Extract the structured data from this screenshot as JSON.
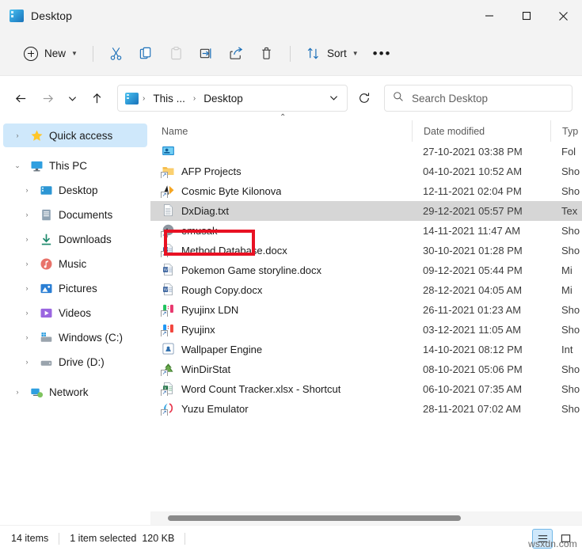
{
  "window": {
    "title": "Desktop",
    "title_icon": "desktop-folder-icon",
    "minimize_label": "Minimize",
    "maximize_label": "Maximize",
    "close_label": "Close"
  },
  "toolbar": {
    "new_label": "New",
    "cut_label": "Cut",
    "copy_label": "Copy",
    "paste_label": "Paste",
    "rename_label": "Rename",
    "share_label": "Share",
    "delete_label": "Delete",
    "sort_label": "Sort",
    "more_label": "See more"
  },
  "addressbar": {
    "back_label": "Back",
    "forward_label": "Forward",
    "recent_label": "Recent locations",
    "up_label": "Up",
    "crumb_root": "This ...",
    "crumb_current": "Desktop",
    "crumb_sep": "›",
    "refresh_label": "Refresh",
    "dropdown_label": "Previous locations"
  },
  "search": {
    "placeholder": "Search Desktop",
    "value": "",
    "icon": "search-icon"
  },
  "sidebar": {
    "items": [
      {
        "label": "Quick access",
        "icon": "star-icon",
        "level": 1,
        "expander": "›",
        "selected": true
      },
      {
        "label": "This PC",
        "icon": "monitor-icon",
        "level": 1,
        "expander": "⌄",
        "selected": false
      },
      {
        "label": "Desktop",
        "icon": "desktop-icon",
        "level": 2,
        "expander": "›",
        "selected": false
      },
      {
        "label": "Documents",
        "icon": "documents-icon",
        "level": 2,
        "expander": "›",
        "selected": false
      },
      {
        "label": "Downloads",
        "icon": "downloads-icon",
        "level": 2,
        "expander": "›",
        "selected": false
      },
      {
        "label": "Music",
        "icon": "music-icon",
        "level": 2,
        "expander": "›",
        "selected": false
      },
      {
        "label": "Pictures",
        "icon": "pictures-icon",
        "level": 2,
        "expander": "›",
        "selected": false
      },
      {
        "label": "Videos",
        "icon": "videos-icon",
        "level": 2,
        "expander": "›",
        "selected": false
      },
      {
        "label": "Windows (C:)",
        "icon": "system-drive-icon",
        "level": 2,
        "expander": "›",
        "selected": false
      },
      {
        "label": "Drive (D:)",
        "icon": "drive-icon",
        "level": 2,
        "expander": "›",
        "selected": false
      },
      {
        "label": "Network",
        "icon": "network-icon",
        "level": 1,
        "expander": "›",
        "selected": false
      }
    ]
  },
  "filelist": {
    "columns": [
      "Name",
      "Date modified",
      "Typ"
    ],
    "sort_indicator": "⌃",
    "rows": [
      {
        "name": "",
        "date": "27-10-2021 03:38 PM",
        "type": "Fol",
        "icon": "desktop-shortcut-icon",
        "shortcut": false,
        "selected": false
      },
      {
        "name": "AFP Projects",
        "date": "04-10-2021 10:52 AM",
        "type": "Sho",
        "icon": "folder-icon",
        "shortcut": true,
        "selected": false
      },
      {
        "name": "Cosmic Byte Kilonova",
        "date": "12-11-2021 02:04 PM",
        "type": "Sho",
        "icon": "app-cosmic-icon",
        "shortcut": true,
        "selected": false
      },
      {
        "name": "DxDiag.txt",
        "date": "29-12-2021 05:57 PM",
        "type": "Tex",
        "icon": "text-file-icon",
        "shortcut": false,
        "selected": true
      },
      {
        "name": "emusak",
        "date": "14-11-2021 11:47 AM",
        "type": "Sho",
        "icon": "app-emusak-icon",
        "shortcut": true,
        "selected": false
      },
      {
        "name": "Method Database.docx",
        "date": "30-10-2021 01:28 PM",
        "type": "Sho",
        "icon": "word-doc-icon",
        "shortcut": true,
        "selected": false
      },
      {
        "name": "Pokemon Game storyline.docx",
        "date": "09-12-2021 05:44 PM",
        "type": "Mi",
        "icon": "word-doc-icon",
        "shortcut": false,
        "selected": false
      },
      {
        "name": "Rough Copy.docx",
        "date": "28-12-2021 04:05 AM",
        "type": "Mi",
        "icon": "word-doc-icon",
        "shortcut": false,
        "selected": false
      },
      {
        "name": "Ryujinx LDN",
        "date": "26-11-2021 01:23 AM",
        "type": "Sho",
        "icon": "ryujinx-ldn-icon",
        "shortcut": true,
        "selected": false
      },
      {
        "name": "Ryujinx",
        "date": "03-12-2021 11:05 AM",
        "type": "Sho",
        "icon": "ryujinx-icon",
        "shortcut": true,
        "selected": false
      },
      {
        "name": "Wallpaper Engine",
        "date": "14-10-2021 08:12 PM",
        "type": "Int",
        "icon": "wallpaper-engine-icon",
        "shortcut": false,
        "selected": false
      },
      {
        "name": "WinDirStat",
        "date": "08-10-2021 05:06 PM",
        "type": "Sho",
        "icon": "windirstat-icon",
        "shortcut": true,
        "selected": false
      },
      {
        "name": "Word Count Tracker.xlsx - Shortcut",
        "date": "06-10-2021 07:35 AM",
        "type": "Sho",
        "icon": "excel-doc-icon",
        "shortcut": true,
        "selected": false
      },
      {
        "name": "Yuzu Emulator",
        "date": "28-11-2021 07:02 AM",
        "type": "Sho",
        "icon": "yuzu-icon",
        "shortcut": true,
        "selected": false
      }
    ]
  },
  "statusbar": {
    "item_count": "14 items",
    "selection_count": "1 item selected",
    "selection_size": "120 KB",
    "details_view_label": "Details view",
    "large_icons_view_label": "Large icons view"
  },
  "annotation": {
    "highlight_target": "DxDiag.txt",
    "highlight_color": "#e81123"
  },
  "watermark": {
    "text": "wsxdn.com"
  }
}
